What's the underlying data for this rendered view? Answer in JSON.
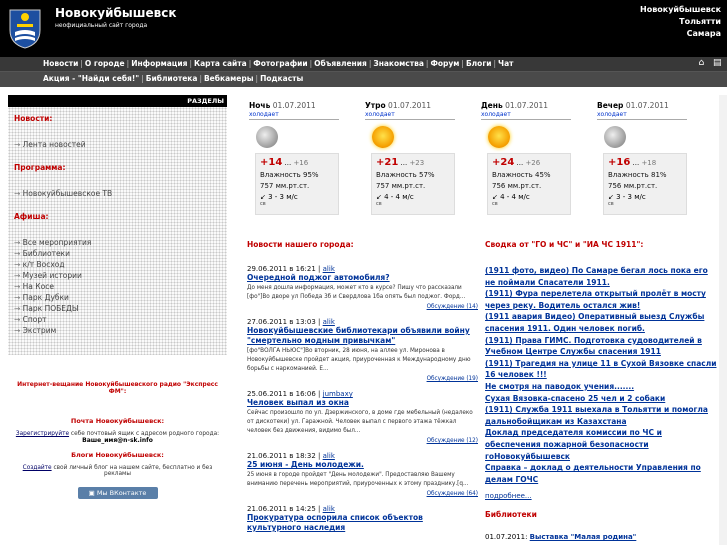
{
  "header": {
    "title": "Новокуйбышевск",
    "subtitle": "неофициальный сайт города",
    "cities": [
      "Новокуйбышевск",
      "Тольятти",
      "Самара"
    ]
  },
  "nav_primary": [
    "Новости",
    "О городе",
    "Информация",
    "Карта сайта",
    "Фотографии",
    "Объявления",
    "Знакомства",
    "Форум",
    "Блоги",
    "Чат"
  ],
  "nav_secondary": [
    "Акция - \"Найди себя!\"",
    "Библиотека",
    "Вебкамеры",
    "Подкасты"
  ],
  "nav_icons": [
    "home-icon",
    "print-icon"
  ],
  "sidebar": {
    "header": "РАЗДЕЛЫ",
    "sections": [
      {
        "title": "Новости:",
        "items": [
          "Лента новостей"
        ]
      },
      {
        "title": "Программа:",
        "items": [
          "Новокуйбышевское ТВ"
        ]
      },
      {
        "title": "Афиша:",
        "items": [
          "Все мероприятия",
          "Библиотеки",
          "к/т Восход",
          "Музей истории",
          "На Косе",
          "Парк Дубки",
          "Парк ПОБЕДЫ",
          "Спорт",
          "Экстрим"
        ]
      }
    ],
    "radio": "Интернет-вещание Новокуйбышевского радио \"Экспресс ФМ\":",
    "post": {
      "title": "Почта Новокуйбышевск:",
      "link": "Зарегистрируйте",
      "text": "себе почтовый ящик с адресом родного города:",
      "email": "Ваше_имя@n-sk.info"
    },
    "blogs": {
      "title": "Блоги Новокуйбышевск:",
      "link": "Создайте",
      "text": "свой личный блог на нашем сайте, бесплатно и без рекламы"
    },
    "vk_button": "Мы ВКонтакте"
  },
  "weather": [
    {
      "period": "Ночь",
      "date": "01.07.2011",
      "sub": "холодает",
      "icon": "moon",
      "temp": "+14",
      "temp_alt": "+16",
      "humidity": "Влажность 95%",
      "pressure": "757 мм.рт.ст.",
      "wind": "3 - 3 м/с",
      "dir": "св"
    },
    {
      "period": "Утро",
      "date": "01.07.2011",
      "sub": "холодает",
      "icon": "sun",
      "temp": "+21",
      "temp_alt": "+23",
      "humidity": "Влажность 57%",
      "pressure": "757 мм.рт.ст.",
      "wind": "4 - 4 м/с",
      "dir": "св"
    },
    {
      "period": "День",
      "date": "01.07.2011",
      "sub": "холодает",
      "icon": "sun",
      "temp": "+24",
      "temp_alt": "+26",
      "humidity": "Влажность 45%",
      "pressure": "756 мм.рт.ст.",
      "wind": "4 - 4 м/с",
      "dir": "св"
    },
    {
      "period": "Вечер",
      "date": "01.07.2011",
      "sub": "холодает",
      "icon": "moon",
      "temp": "+16",
      "temp_alt": "+18",
      "humidity": "Влажность 81%",
      "pressure": "756 мм.рт.ст.",
      "wind": "3 - 3 м/с",
      "dir": "св"
    }
  ],
  "news": {
    "heading": "Новости нашего города:",
    "items": [
      {
        "date": "29.06.2011 в 16:21",
        "author": "alik",
        "title": "Очередной поджог автомобиля?",
        "body": "До меня дошла информация, может кто в курсе? Пишу что рассказали [фо\"]Во дворе ул Победа 3б и Свердлова 1ба опять был поджог. Форд...",
        "foot": "Обсуждение (14)"
      },
      {
        "date": "27.06.2011 в 13:03",
        "author": "alik",
        "title": "Новокуйбышевские библиотекари объявили войну \"смертельно модным привычкам\"",
        "body": "[фо\"ВОЛГА НЬЮС\"]Во вторник, 28 июня, на аллее ул. Миронова в Новокуйбышевске пройдет акция, приуроченная к Международному дню борьбы с наркоманией. Е...",
        "foot": "Обсуждение (19)"
      },
      {
        "date": "25.06.2011 в 16:06",
        "author": "jumbaxy",
        "title": "Человек выпал из окна",
        "body": "Сейчас произошло по ул. Дзержинского, в доме где мебельный (недалеко от дискотеки) ул. Гаражной. Человек выпал с первого этажа тёжкал человек без движения, видимо был...",
        "foot": "Обсуждение (12)"
      },
      {
        "date": "21.06.2011 в 18:32",
        "author": "alik",
        "title": "25 июня - День молодежи.",
        "body": "25 июня в городе пройдет \"День молодежи\". Предоставляю Вашему вниманию перечень мероприятий, приуроченных к этому празднику.[q...",
        "foot": "Обсуждение (64)"
      },
      {
        "date": "21.06.2011 в 14:25",
        "author": "alik",
        "title": "Прокуратура оспорила список объектов культурного наследия",
        "body": "",
        "foot": ""
      }
    ]
  },
  "gochs": {
    "heading": "Сводка от \"ГО и ЧС\" и \"ИА ЧС 1911\":",
    "links": [
      "(1911 фото, видео) По Самаре бегал лось пока его не поймали Спасатели 1911.",
      "(1911) Фура перелетела открытый пролёт в мосту через реку. Водитель остался жив!",
      "(1911 авария Видео) Оперативный выезд Службы спасения 1911. Один человек погиб.",
      "(1911) Права ГИМС. Подготовка судоводителей в Учебном Центре Службы спасения 1911",
      "(1911) Трагедия на улице 11 в Сухой Вязовке спасли 16 человек !!!",
      "Не смотря на паводок учения.......",
      "Сухая Вязовка-спасено 25 чел и 2 собаки",
      "(1911) Служба 1911 выехала в Тольятти и помогла дальнобойщикам из Казахстана",
      "Доклад председателя комиссии по ЧС и обеспечения пожарной безопасности гоНовокуйбышевск",
      "Справка – доклад о деятельности Управления по делам ГОЧС"
    ],
    "more": "подробнее...",
    "library_heading": "Библиотеки",
    "library_date": "01.07.2011:",
    "library_link": "Выставка \"Малая родина\""
  }
}
